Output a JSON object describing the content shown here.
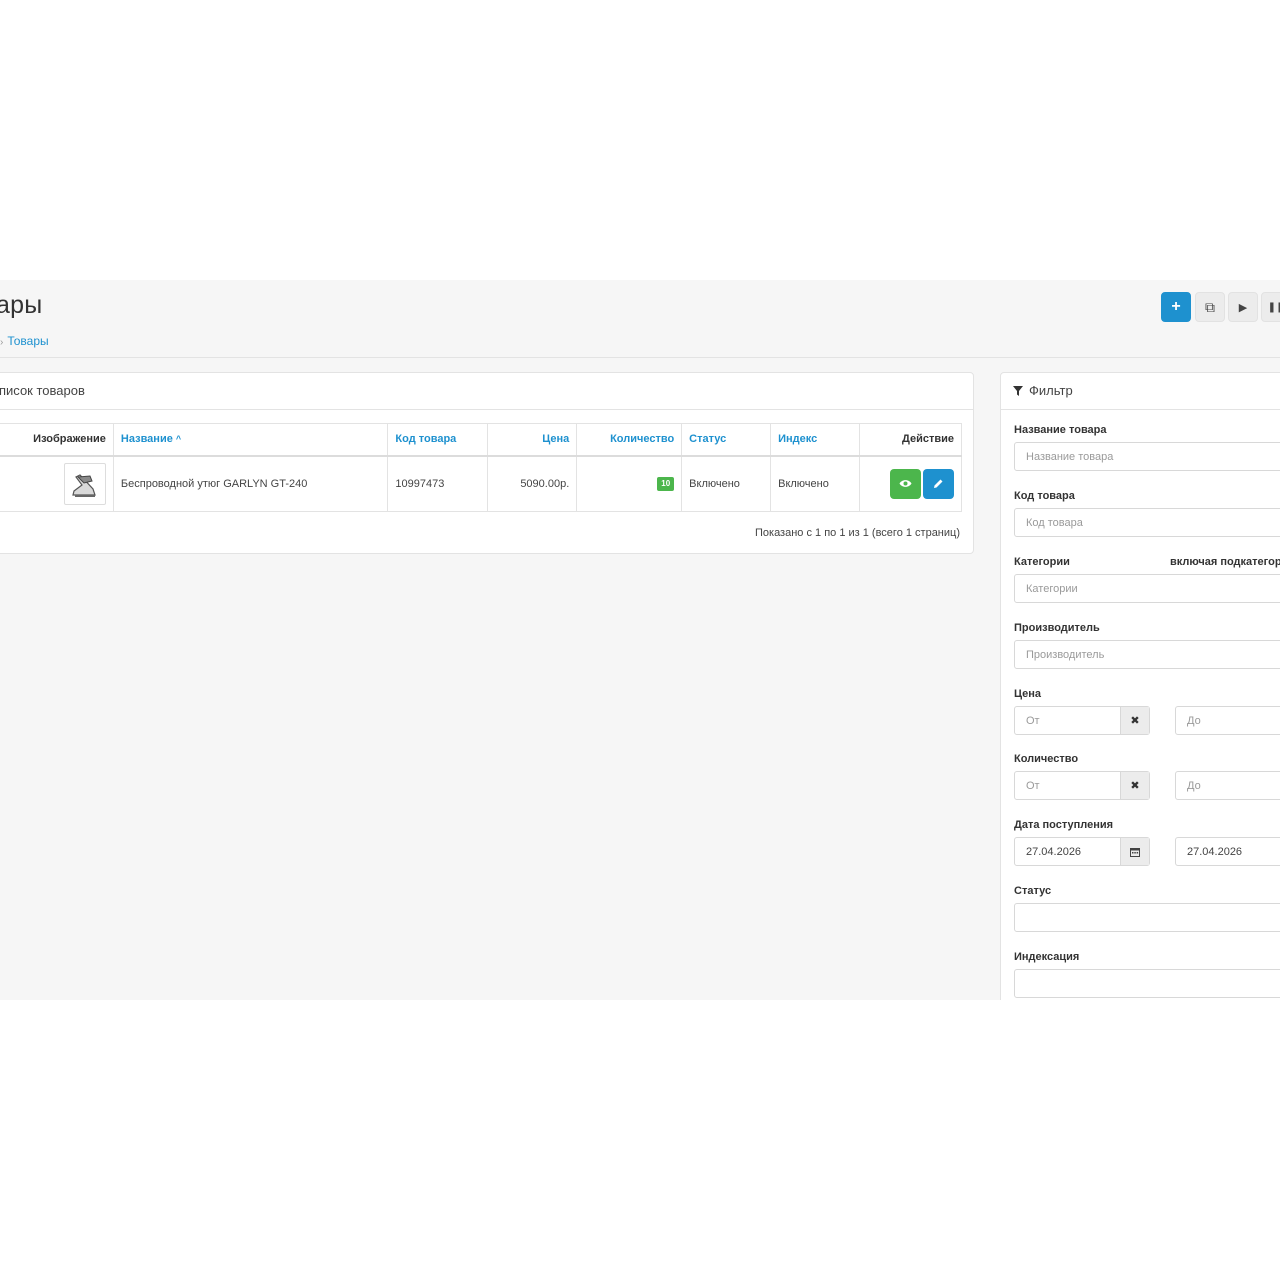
{
  "header": {
    "title": "ары",
    "breadcrumb": [
      "",
      "Товары"
    ],
    "toolbar": [
      {
        "name": "add-button",
        "icon": "plus-icon",
        "glyph": "+"
      },
      {
        "name": "copy-button",
        "icon": "copy-icon",
        "glyph": "⧉"
      },
      {
        "name": "play-button",
        "icon": "play-icon",
        "glyph": "▶"
      },
      {
        "name": "pause-button",
        "icon": "pause-icon",
        "glyph": "❚❚"
      }
    ]
  },
  "list": {
    "title": "писок товаров",
    "columns": {
      "image": "Изображение",
      "name": "Название",
      "code": "Код товара",
      "price": "Цена",
      "quantity": "Количество",
      "status": "Статус",
      "index": "Индекс",
      "action": "Действие"
    },
    "sort_indicator": "^",
    "rows": [
      {
        "name": "Беспроводной утюг GARLYN GT-240",
        "code": "10997473",
        "price": "5090.00р.",
        "quantity": "10",
        "status": "Включено",
        "index": "Включено"
      }
    ],
    "pagination": "Показано с 1 по 1 из 1 (всего 1 страниц)"
  },
  "filter": {
    "title": "Фильтр",
    "product_name": {
      "label": "Название товара",
      "placeholder": "Название товара"
    },
    "product_code": {
      "label": "Код товара",
      "placeholder": "Код товара"
    },
    "categories": {
      "label": "Категории",
      "sub_label": "включая подкатегор",
      "placeholder": "Категории"
    },
    "manufacturer": {
      "label": "Производитель",
      "placeholder": "Производитель"
    },
    "price": {
      "label": "Цена",
      "from": "От",
      "to": "До",
      "clear": "✖"
    },
    "quantity": {
      "label": "Количество",
      "from": "От",
      "to": "До",
      "clear": "✖"
    },
    "date_added": {
      "label": "Дата поступления",
      "from": "27.04.2026",
      "to": "27.04.2026"
    },
    "status": {
      "label": "Статус"
    },
    "indexing": {
      "label": "Индексация"
    }
  },
  "colors": {
    "primary": "#1e91cf",
    "success": "#4cb64c",
    "background": "#f6f6f6"
  }
}
